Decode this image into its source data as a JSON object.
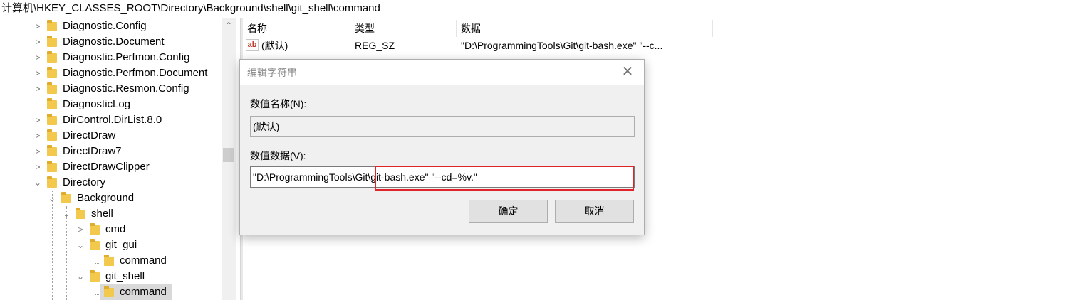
{
  "address_bar": {
    "path": "计算机\\HKEY_CLASSES_ROOT\\Directory\\Background\\shell\\git_shell\\command"
  },
  "tree": {
    "items": [
      {
        "label": "Diagnostic.Config",
        "chevron": ">"
      },
      {
        "label": "Diagnostic.Document",
        "chevron": ">"
      },
      {
        "label": "Diagnostic.Perfmon.Config",
        "chevron": ">"
      },
      {
        "label": "Diagnostic.Perfmon.Document",
        "chevron": ">"
      },
      {
        "label": "Diagnostic.Resmon.Config",
        "chevron": ">"
      },
      {
        "label": "DiagnosticLog",
        "chevron": ""
      },
      {
        "label": "DirControl.DirList.8.0",
        "chevron": ">"
      },
      {
        "label": "DirectDraw",
        "chevron": ">"
      },
      {
        "label": "DirectDraw7",
        "chevron": ">"
      },
      {
        "label": "DirectDrawClipper",
        "chevron": ">"
      },
      {
        "label": "Directory",
        "chevron": "v"
      },
      {
        "label": "Background",
        "chevron": "v"
      },
      {
        "label": "shell",
        "chevron": "v"
      },
      {
        "label": "cmd",
        "chevron": ">"
      },
      {
        "label": "git_gui",
        "chevron": "v"
      },
      {
        "label": "command",
        "chevron": ""
      },
      {
        "label": "git_shell",
        "chevron": "v"
      },
      {
        "label": "command",
        "chevron": "",
        "selected": true
      }
    ]
  },
  "list": {
    "headers": {
      "name": "名称",
      "type": "类型",
      "data": "数据"
    },
    "rows": [
      {
        "icon": "ab",
        "name": "(默认)",
        "type": "REG_SZ",
        "data": "\"D:\\ProgrammingTools\\Git\\git-bash.exe\" \"--c..."
      }
    ]
  },
  "dialog": {
    "title": "编辑字符串",
    "close_glyph": "✕",
    "value_name_label": "数值名称(N):",
    "value_name": "(默认)",
    "value_data_label": "数值数据(V):",
    "value_data": "\"D:\\ProgrammingTools\\Git\\git-bash.exe\" \"--cd=%v.\"",
    "ok_label": "确定",
    "cancel_label": "取消"
  },
  "colors": {
    "highlight_box": "#e0242a",
    "folder": "#f2c94c"
  }
}
